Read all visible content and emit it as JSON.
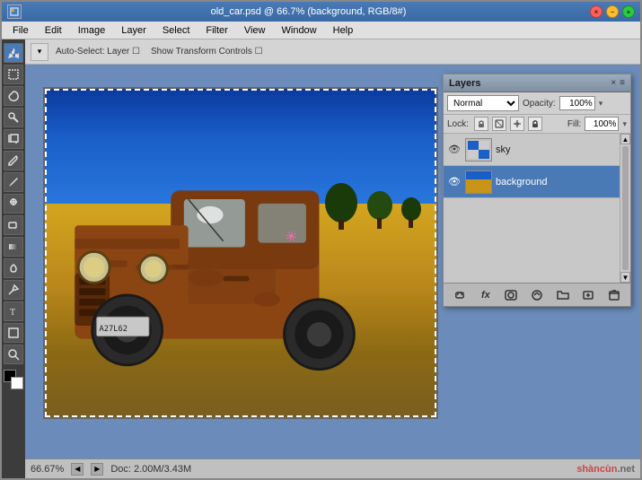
{
  "window": {
    "title": "old_car.psd @ 66.7% (background, RGB/8#)",
    "controls": {
      "close": "×",
      "minimize": "−",
      "maximize": "+"
    }
  },
  "menubar": {
    "items": [
      "File",
      "Edit",
      "Image",
      "Layer",
      "Select",
      "Filter",
      "View",
      "Window",
      "Help"
    ]
  },
  "layers_panel": {
    "title": "Layers",
    "close_btn": "×",
    "menu_btn": "≡",
    "blend_mode": "Normal",
    "opacity_label": "Opacity:",
    "opacity_value": "100%",
    "lock_label": "Lock:",
    "fill_label": "Fill:",
    "fill_value": "100%",
    "layers": [
      {
        "name": "sky",
        "visible": true,
        "active": false,
        "thumb_type": "sky"
      },
      {
        "name": "background",
        "visible": true,
        "active": true,
        "thumb_type": "bg"
      }
    ],
    "bottom_tools": [
      "🔗",
      "fx",
      "□",
      "◎",
      "▭",
      "🗑"
    ]
  },
  "statusbar": {
    "zoom": "66.67%",
    "doc_info": "Doc: 2.00M/3.43M",
    "watermark_line1": "shàncùn",
    "watermark_line2": ".net"
  },
  "canvas": {
    "cursor_symbol": "✳"
  }
}
